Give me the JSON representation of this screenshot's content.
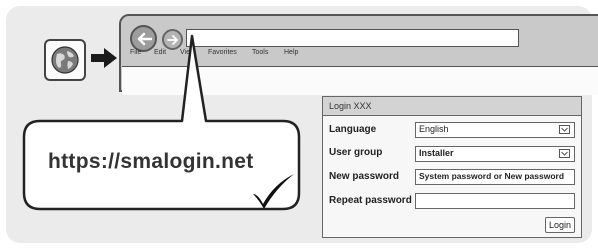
{
  "menu": [
    "File",
    "Edit",
    "View",
    "Favorites",
    "Tools",
    "Help"
  ],
  "callout_url": "https://smalogin.net",
  "login": {
    "title": "Login XXX",
    "language_label": "Language",
    "language_value": "English",
    "user_group_label": "User group",
    "user_group_value": "Installer",
    "new_password_label": "New password",
    "new_password_value": "System password or New password",
    "repeat_password_label": "Repeat password",
    "repeat_password_value": "",
    "login_button": "Login"
  },
  "icons": [
    "globe-icon",
    "arrow-right-icon",
    "back-arrow-icon",
    "forward-arrow-icon",
    "checkmark-icon",
    "dropdown-check-icon"
  ],
  "colors": {
    "panel": "#ebebeb",
    "browser_chrome": "#c9c9c9",
    "outline": "#555555"
  }
}
